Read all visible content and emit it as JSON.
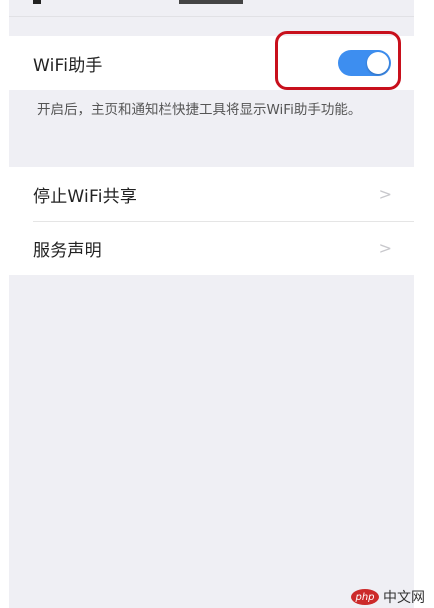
{
  "wifi_assistant": {
    "label": "WiFi助手",
    "enabled": true,
    "description": "开启后，主页和通知栏快捷工具将显示WiFi助手功能。"
  },
  "menu": [
    {
      "label": "停止WiFi共享",
      "chevron": ">"
    },
    {
      "label": "服务声明",
      "chevron": ">"
    }
  ],
  "colors": {
    "toggle_on": "#3d8ef0",
    "highlight_box": "#c8101c",
    "background": "#efeff4"
  },
  "watermark": {
    "logo": "php",
    "text": "中文网"
  }
}
